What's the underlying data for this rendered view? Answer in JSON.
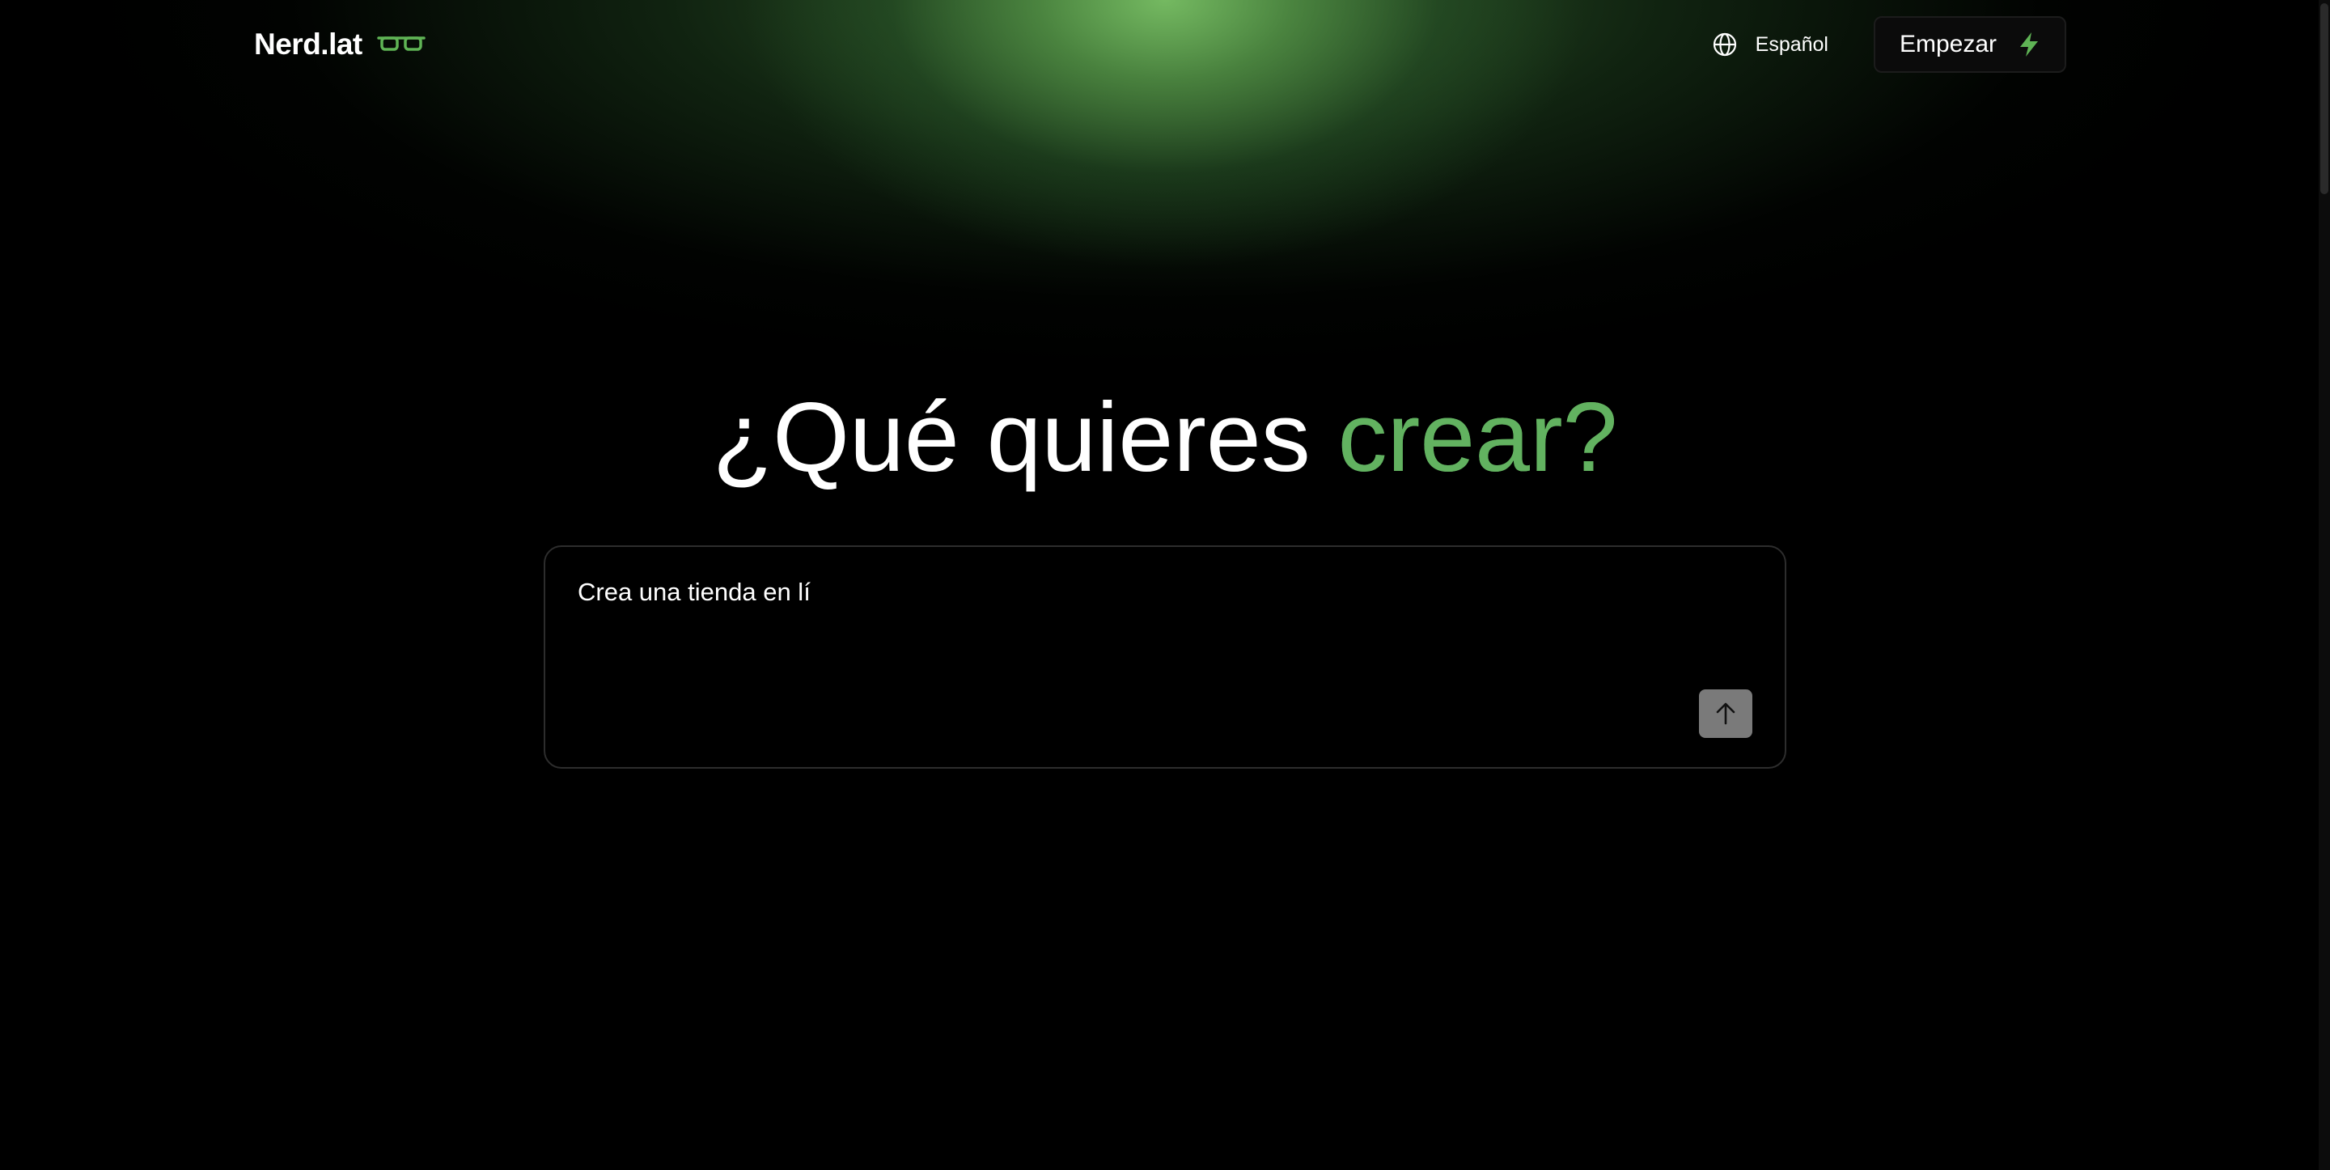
{
  "header": {
    "brand": "Nerd.lat",
    "brand_icon": "glasses-icon",
    "language_icon": "globe-icon",
    "language_label": "Español",
    "cta_label": "Empezar",
    "cta_icon": "lightning-bolt-icon"
  },
  "hero": {
    "title_main": "¿Qué quieres",
    "title_accent": "crear?"
  },
  "prompt": {
    "value": "Crea una tienda en lí",
    "send_icon": "arrow-up-icon"
  },
  "colors": {
    "accent_green": "#62b260",
    "glow_green": "#6fb45a",
    "background": "#000000",
    "send_button": "#7a7a7a"
  }
}
